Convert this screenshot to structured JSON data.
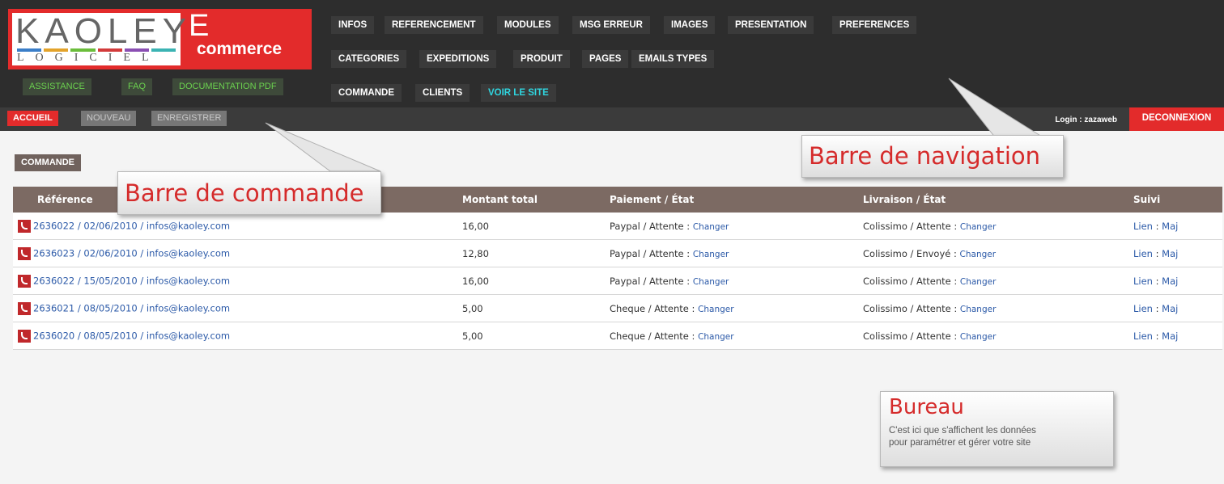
{
  "logo": {
    "kaoley": "KAOLEY",
    "logiciel": "LOGICIEL",
    "e": "E",
    "commerce": "commerce"
  },
  "quick_links": [
    "ASSISTANCE",
    "FAQ",
    "DOCUMENTATION PDF"
  ],
  "nav": {
    "row1": [
      "INFOS",
      "REFERENCEMENT",
      "MODULES",
      "MSG ERREUR",
      "IMAGES",
      "PRESENTATION",
      "PREFERENCES"
    ],
    "row2": [
      "CATEGORIES",
      "EXPEDITIONS",
      "PRODUIT",
      "PAGES",
      "EMAILS TYPES"
    ],
    "row3": [
      "COMMANDE",
      "CLIENTS",
      "VOIR LE SITE"
    ]
  },
  "command_bar": {
    "accueil": "ACCUEIL",
    "nouveau": "NOUVEAU",
    "enregistrer": "ENREGISTRER"
  },
  "login": {
    "label": "Login :",
    "user": "zazaweb",
    "logout": "DECONNEXION"
  },
  "section_tag": "COMMANDE",
  "table": {
    "headers": [
      "Référence",
      "Montant total",
      "Paiement / État",
      "Livraison / État",
      "Suivi"
    ],
    "change_label": "Changer",
    "lien_label": "Lien",
    "sep": ":",
    "maj_label": "Maj",
    "rows": [
      {
        "ref": "2636022 / 02/06/2010 / infos@kaoley.com",
        "amount": "16,00",
        "payment": "Paypal / Attente :",
        "delivery": "Colissimo / Attente :"
      },
      {
        "ref": "2636023 / 02/06/2010 / infos@kaoley.com",
        "amount": "12,80",
        "payment": "Paypal / Attente :",
        "delivery": "Colissimo / Envoyé :"
      },
      {
        "ref": "2636022 / 15/05/2010 / infos@kaoley.com",
        "amount": "16,00",
        "payment": "Paypal / Attente :",
        "delivery": "Colissimo / Attente :"
      },
      {
        "ref": "2636021 / 08/05/2010 / infos@kaoley.com",
        "amount": "5,00",
        "payment": "Cheque / Attente :",
        "delivery": "Colissimo / Attente :"
      },
      {
        "ref": "2636020 / 08/05/2010 / infos@kaoley.com",
        "amount": "5,00",
        "payment": "Cheque / Attente :",
        "delivery": "Colissimo / Attente :"
      }
    ]
  },
  "callouts": {
    "commande": "Barre de commande",
    "navigation": "Barre de navigation",
    "bureau_title": "Bureau",
    "bureau_line1": "C'est ici que s'affichent les données",
    "bureau_line2": "pour paramétrer et gérer votre site"
  },
  "colors": {
    "accent": "#e32b2b",
    "header": "#2d2d2d",
    "table_header": "#7c6a63",
    "link": "#2c5aa8"
  }
}
